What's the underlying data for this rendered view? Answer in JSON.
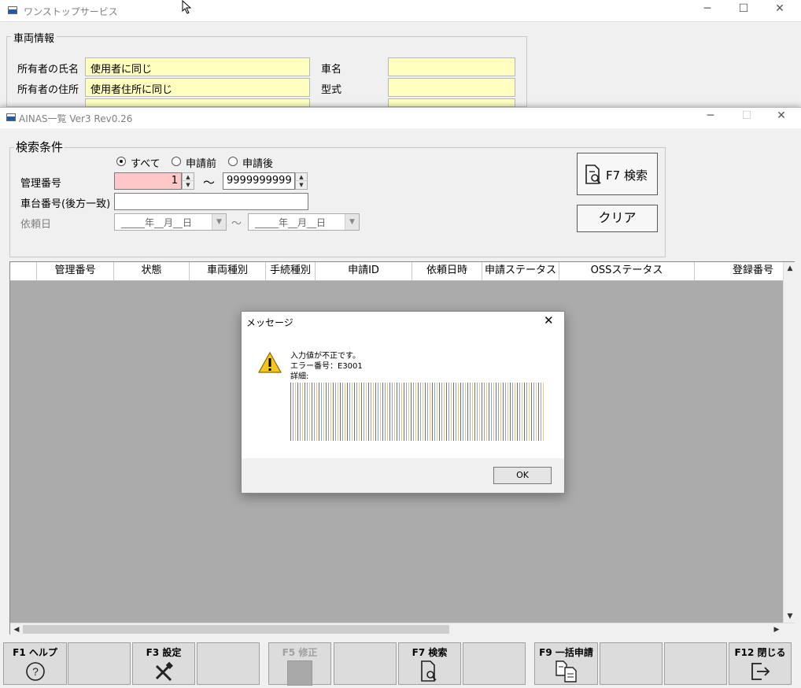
{
  "bg_window": {
    "title": "ワンストップサービス",
    "group_label": "車両情報",
    "rows": [
      {
        "label": "所有者の氏名",
        "value": "使用者に同じ",
        "right_label": "車名",
        "right_value": ""
      },
      {
        "label": "所有者の住所",
        "value": "使用者住所に同じ",
        "right_label": "型式",
        "right_value": ""
      }
    ]
  },
  "main_window": {
    "title": "AINAS一覧 Ver3 Rev0.26",
    "search": {
      "group_label": "検索条件",
      "radios": [
        {
          "label": "すべて",
          "selected": true
        },
        {
          "label": "申請前",
          "selected": false
        },
        {
          "label": "申請後",
          "selected": false
        }
      ],
      "mgmt_label": "管理番号",
      "mgmt_from": "1",
      "tilde": "〜",
      "mgmt_to": "9999999999",
      "chassis_label": "車台番号(後方一致)",
      "chassis_value": "",
      "date_label": "依頼日",
      "date_from": "_____年__月__日",
      "date_to": "_____年__月__日",
      "search_button": "F7 検索",
      "clear_button": "クリア"
    },
    "grid": {
      "columns": [
        "",
        "管理番号",
        "状態",
        "車両種別",
        "手続種別",
        "申請ID",
        "依頼日時",
        "申請ステータス",
        "OSSステータス",
        "登録番号"
      ]
    }
  },
  "dialog": {
    "title": "メッセージ",
    "line1": "入力値が不正です。",
    "line2": "エラー番号：E3001",
    "line3": "詳細:",
    "ok_button": "OK"
  },
  "fkeys": [
    {
      "label": "F1 ヘルプ",
      "icon": "help-icon",
      "glyph": "?",
      "enabled": true
    },
    {
      "label": "",
      "icon": "",
      "glyph": "",
      "enabled": true
    },
    {
      "label": "F3 設定",
      "icon": "tools-icon",
      "glyph": "⚒",
      "enabled": true
    },
    {
      "label": "",
      "icon": "",
      "glyph": "",
      "enabled": true
    },
    {
      "label": "F5 修正",
      "icon": "edit-icon",
      "glyph": "",
      "enabled": false
    },
    {
      "label": "",
      "icon": "",
      "glyph": "",
      "enabled": true
    },
    {
      "label": "F7 検索",
      "icon": "search-doc-icon",
      "glyph": "🔍",
      "enabled": true
    },
    {
      "label": "",
      "icon": "",
      "glyph": "",
      "enabled": true
    },
    {
      "label": "F9 一括申請",
      "icon": "batch-doc-icon",
      "glyph": "⎘",
      "enabled": true
    },
    {
      "label": "",
      "icon": "",
      "glyph": "",
      "enabled": true
    },
    {
      "label": "",
      "icon": "",
      "glyph": "",
      "enabled": true
    },
    {
      "label": "F12 閉じる",
      "icon": "exit-icon",
      "glyph": "⇥",
      "enabled": true
    }
  ],
  "colors": {
    "field_yellow": "#ffffc0",
    "field_pink": "#ffc8c8",
    "grid_bg": "#ababab",
    "fkey_bg": "#dcdcdc"
  }
}
